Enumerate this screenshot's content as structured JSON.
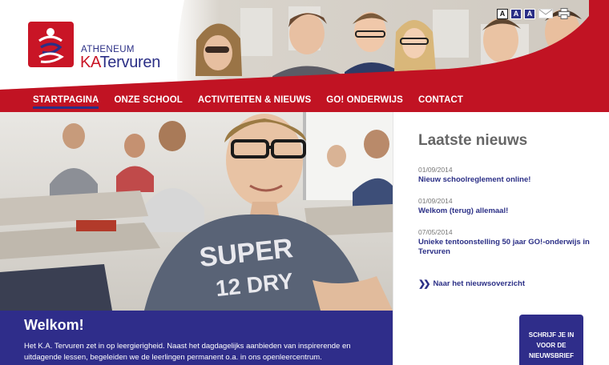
{
  "colors": {
    "brand_red": "#c91526",
    "brand_blue": "#2b2f86",
    "panel_blue": "#2f2d8a"
  },
  "logo": {
    "line1": "ATHENEUM",
    "line2_ka": "KA",
    "line2_rest": "Tervuren"
  },
  "utility": {
    "items": [
      {
        "label": "A",
        "icon": "font-size-small-icon"
      },
      {
        "label": "A",
        "icon": "font-size-medium-icon"
      },
      {
        "label": "A",
        "icon": "font-size-large-icon"
      },
      {
        "label": "",
        "icon": "mail-icon"
      },
      {
        "label": "",
        "icon": "print-icon"
      }
    ]
  },
  "nav": {
    "items": [
      {
        "label": "STARTPAGINA",
        "active": true
      },
      {
        "label": "ONZE SCHOOL",
        "active": false
      },
      {
        "label": "ACTIVITEITEN & NIEUWS",
        "active": false
      },
      {
        "label": "GO! ONDERWIJS",
        "active": false
      },
      {
        "label": "CONTACT",
        "active": false
      }
    ]
  },
  "hero": {
    "shirt_text_1": "SUPER",
    "shirt_text_2": "12 DRY"
  },
  "welkom": {
    "title": "Welkom!",
    "text": "Het K.A. Tervuren zet in op leergierigheid. Naast het dagdagelijks aanbieden van inspirerende en uitdagende lessen, begeleiden we de leerlingen permanent o.a. in ons openleercentrum."
  },
  "news": {
    "title": "Laatste nieuws",
    "items": [
      {
        "date": "01/09/2014",
        "title": "Nieuw schoolreglement online!"
      },
      {
        "date": "01/09/2014",
        "title": "Welkom (terug) allemaal!"
      },
      {
        "date": "07/05/2014",
        "title": "Unieke tentoonstelling 50 jaar GO!-onderwijs in Tervuren"
      }
    ],
    "more_label": "Naar het nieuwsoverzicht",
    "more_icon": "double-chevron-right-icon"
  },
  "newsletter": {
    "line1": "SCHRIJF JE IN",
    "line2": "VOOR DE",
    "line3": "NIEUWSBRIEF"
  }
}
